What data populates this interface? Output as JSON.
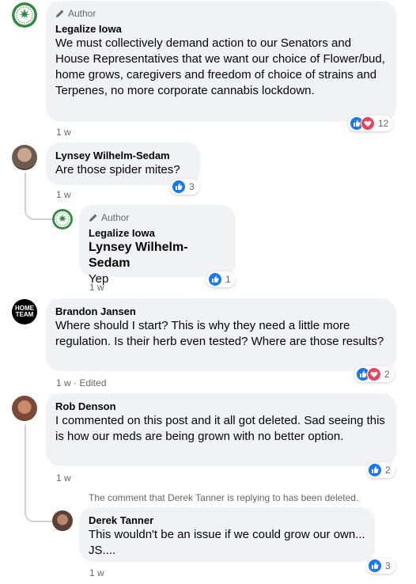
{
  "comments": {
    "c1": {
      "badge": "Author",
      "name": "Legalize Iowa",
      "text": "We must collectively demand action to our Senators and House Representatives that we want our choice of Flower/bud, home grows, caregivers and freedom of choice of strains and Terpenes, no more corporate cannabis lockdown.",
      "time": "1 w",
      "reaction_count": "12",
      "reactions": [
        "like-icon",
        "love-icon"
      ]
    },
    "c2": {
      "name": "Lynsey Wilhelm-Sedam",
      "text": "Are those spider mites?",
      "time": "1 w",
      "reaction_count": "3",
      "reactions": [
        "like-icon"
      ]
    },
    "c3": {
      "badge": "Author",
      "name": "Legalize Iowa",
      "mention": "Lynsey Wilhelm-Sedam",
      "text": "Yep",
      "time": "1 w",
      "reaction_count": "1",
      "reactions": [
        "like-icon"
      ]
    },
    "c4": {
      "name": "Brandon Jansen",
      "text": "Where should I start? This is why they need a little more regulation. Is their herb even tested? Where are those results?",
      "time": "1 w · Edited",
      "reaction_count": "2",
      "reactions": [
        "like-icon",
        "love-icon"
      ],
      "avatar_text": "HOME TEAM"
    },
    "c5": {
      "name": "Rob Denson",
      "text": "I commented on this post and it all got deleted. Sad seeing this is how our meds are being grown with no better option.",
      "time": "1 w",
      "reaction_count": "2",
      "reactions": [
        "like-icon"
      ]
    },
    "deleted_note": "The comment that Derek Tanner is replying to has been deleted.",
    "c6": {
      "name": "Derek Tanner",
      "text": "This wouldn't be an issue if we could grow our own... JS....",
      "time": "1 w",
      "reaction_count": "3",
      "reactions": [
        "like-icon"
      ]
    }
  },
  "colors": {
    "bubble": "#f0f2f5",
    "like": "#1877f2",
    "love": "#f33e58",
    "meta": "#65676b"
  }
}
